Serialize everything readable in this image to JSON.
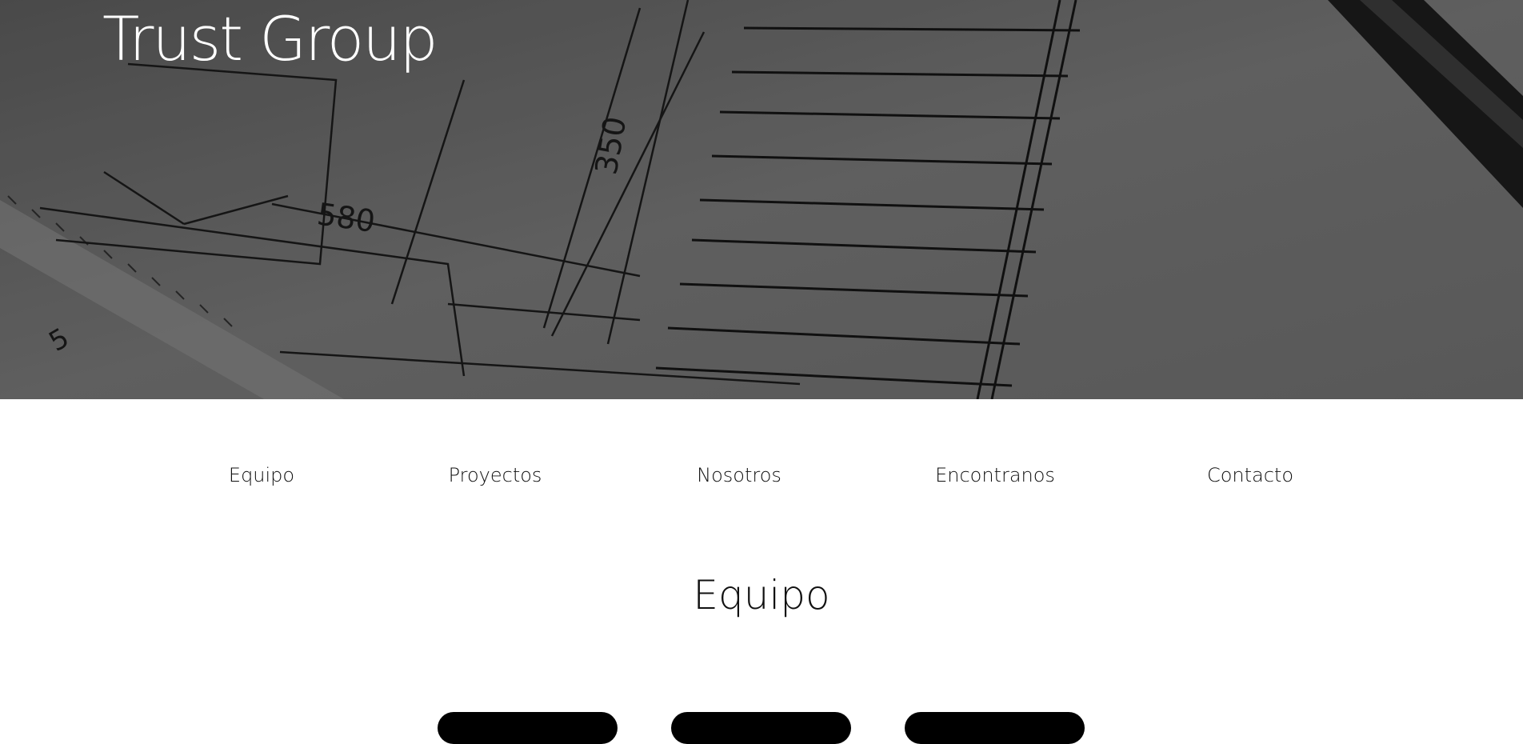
{
  "hero": {
    "title": "Trust Group"
  },
  "nav": {
    "items": [
      {
        "label": "Equipo"
      },
      {
        "label": "Proyectos"
      },
      {
        "label": "Nosotros"
      },
      {
        "label": "Encontranos"
      },
      {
        "label": "Contacto"
      }
    ]
  },
  "section": {
    "title": "Equipo"
  }
}
